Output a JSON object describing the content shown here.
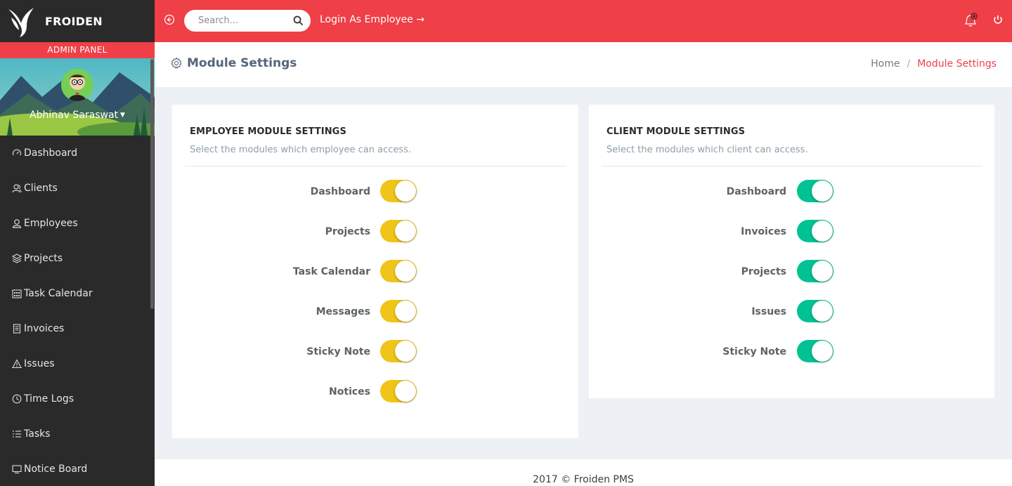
{
  "brand": {
    "name": "FROIDEN",
    "panel_label": "ADMIN PANEL"
  },
  "user": {
    "name": "Abhinav Saraswat"
  },
  "sidebar": {
    "items": [
      {
        "label": "Dashboard",
        "icon": "speedometer-icon"
      },
      {
        "label": "Clients",
        "icon": "user-group-icon"
      },
      {
        "label": "Employees",
        "icon": "user-icon"
      },
      {
        "label": "Projects",
        "icon": "layers-icon"
      },
      {
        "label": "Task Calendar",
        "icon": "calendar-icon"
      },
      {
        "label": "Invoices",
        "icon": "document-icon"
      },
      {
        "label": "Issues",
        "icon": "warning-icon"
      },
      {
        "label": "Time Logs",
        "icon": "clock-icon"
      },
      {
        "label": "Tasks",
        "icon": "list-icon"
      },
      {
        "label": "Notice Board",
        "icon": "monitor-icon"
      }
    ]
  },
  "topbar": {
    "search_placeholder": "Search...",
    "login_as_employee": "Login As Employee →"
  },
  "page": {
    "title": "Module Settings",
    "breadcrumb": {
      "home": "Home",
      "current": "Module Settings"
    }
  },
  "employee_settings": {
    "title": "EMPLOYEE MODULE SETTINGS",
    "subtitle": "Select the modules which employee can access.",
    "toggle_color": "#f0c418",
    "modules": [
      {
        "label": "Dashboard",
        "enabled": true
      },
      {
        "label": "Projects",
        "enabled": true
      },
      {
        "label": "Task Calendar",
        "enabled": true
      },
      {
        "label": "Messages",
        "enabled": true
      },
      {
        "label": "Sticky Note",
        "enabled": true
      },
      {
        "label": "Notices",
        "enabled": true
      }
    ]
  },
  "client_settings": {
    "title": "CLIENT MODULE SETTINGS",
    "subtitle": "Select the modules which client can access.",
    "toggle_color": "#00c292",
    "modules": [
      {
        "label": "Dashboard",
        "enabled": true
      },
      {
        "label": "Invoices",
        "enabled": true
      },
      {
        "label": "Projects",
        "enabled": true
      },
      {
        "label": "Issues",
        "enabled": true
      },
      {
        "label": "Sticky Note",
        "enabled": true
      }
    ]
  },
  "footer": {
    "text": "2017 © Froiden PMS"
  },
  "colors": {
    "accent": "#ef3f47",
    "sidebar": "#2a2a2a"
  }
}
